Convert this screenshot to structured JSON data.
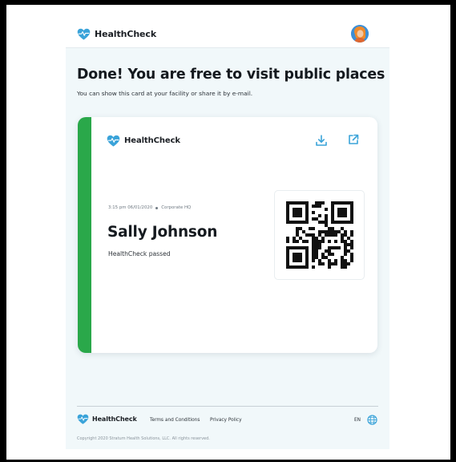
{
  "brand": {
    "name": "HealthCheck",
    "primary_color": "#3aa3d9",
    "pass_color": "#2aa84a"
  },
  "header": {
    "logo_icon": "heart-pulse-icon",
    "avatar_icon": "user-avatar-icon"
  },
  "main": {
    "title": "Done! You are free to visit public places",
    "subtitle": "You can show this card at your facility or share it by e-mail."
  },
  "card": {
    "brand_name": "HealthCheck",
    "timestamp": "3:15 pm 06/01/2020",
    "location": "Corporate HQ",
    "person_name": "Sally Johnson",
    "status": "HealthCheck passed",
    "actions": [
      {
        "icon": "download-icon"
      },
      {
        "icon": "share-icon"
      }
    ],
    "qr_icon": "qr-code-icon"
  },
  "footer": {
    "brand_name": "HealthCheck",
    "links": [
      "Terms and Conditions",
      "Privacy Policy"
    ],
    "language": "EN",
    "language_icon": "globe-icon",
    "copyright": "Copyright 2020 Stratum Health Solutions, LLC. All rights reserved."
  }
}
